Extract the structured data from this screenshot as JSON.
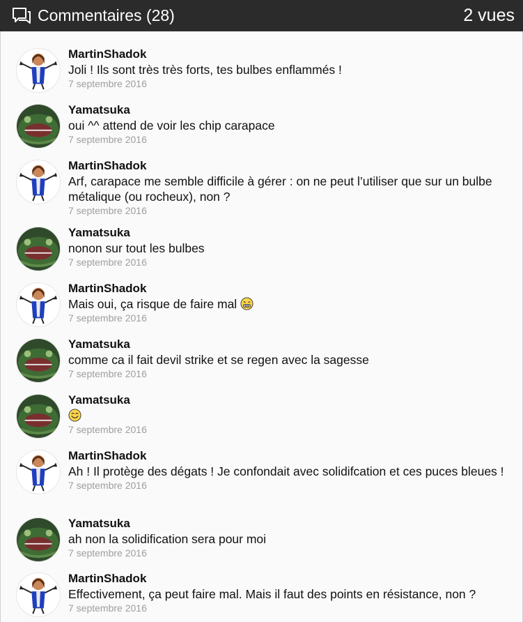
{
  "header": {
    "title": "Commentaires (28)",
    "views": "2 vues",
    "icon": "comments-icon"
  },
  "comments": [
    {
      "author": "MartinShadok",
      "avatar": "martinshadok-avatar",
      "text": "Joli ! Ils sont très très forts, tes bulbes enflammés !",
      "date": "7 septembre 2016"
    },
    {
      "author": "Yamatsuka",
      "avatar": "yamatsuka-avatar",
      "text": "oui ^^ attend de voir les chip carapace",
      "date": "7 septembre 2016"
    },
    {
      "author": "MartinShadok",
      "avatar": "martinshadok-avatar",
      "text": "Arf, carapace me semble difficile à gérer : on ne peut l’utiliser que sur un bulbe métalique (ou rocheux), non ?",
      "date": "7 septembre 2016"
    },
    {
      "author": "Yamatsuka",
      "avatar": "yamatsuka-avatar",
      "text": "nonon sur tout les bulbes",
      "date": "7 septembre 2016"
    },
    {
      "author": "MartinShadok",
      "avatar": "martinshadok-avatar",
      "text": "Mais oui, ça risque de faire mal",
      "emoji": "grimace-emoji",
      "date": "7 septembre 2016"
    },
    {
      "author": "Yamatsuka",
      "avatar": "yamatsuka-avatar",
      "text": "comme ca il fait devil strike et se regen avec la sagesse",
      "date": "7 septembre 2016"
    },
    {
      "author": "Yamatsuka",
      "avatar": "yamatsuka-avatar",
      "text": "",
      "emoji": "smile-emoji",
      "date": "7 septembre 2016"
    },
    {
      "author": "MartinShadok",
      "avatar": "martinshadok-avatar",
      "text": "Ah ! Il protège des dégats ! Je confondait avec solidifcation et ces puces bleues !",
      "date": "7 septembre 2016"
    },
    {
      "author": "Yamatsuka",
      "avatar": "yamatsuka-avatar",
      "text": "ah non la solidification sera pour moi",
      "date": "7 septembre 2016"
    },
    {
      "author": "MartinShadok",
      "avatar": "martinshadok-avatar",
      "text": "Effectivement, ça peut faire mal. Mais il faut des points en résistance, non ?",
      "date": "7 septembre 2016"
    }
  ]
}
